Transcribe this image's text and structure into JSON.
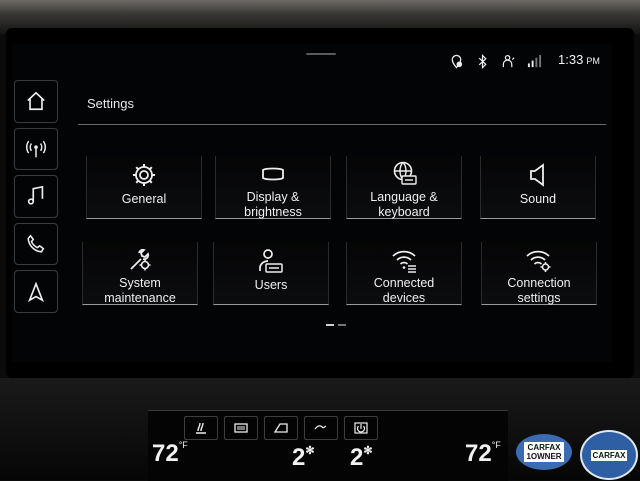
{
  "status_bar": {
    "time": "1:33",
    "ampm": "PM",
    "icons": [
      "location-icon",
      "bluetooth-icon",
      "user-profile-icon",
      "signal-icon"
    ]
  },
  "rail": {
    "items": [
      {
        "name": "home-icon"
      },
      {
        "name": "radio-icon"
      },
      {
        "name": "music-icon"
      },
      {
        "name": "phone-icon"
      },
      {
        "name": "navigation-icon"
      }
    ]
  },
  "page": {
    "title": "Settings"
  },
  "tiles": [
    {
      "label": "General",
      "icon": "gear-icon"
    },
    {
      "label": "Display &\nbrightness",
      "icon": "display-icon"
    },
    {
      "label": "Language &\nkeyboard",
      "icon": "globe-keyboard-icon"
    },
    {
      "label": "Sound",
      "icon": "speaker-icon"
    },
    {
      "label": "System\nmaintenance",
      "icon": "wrench-gear-icon"
    },
    {
      "label": "Users",
      "icon": "user-icon"
    },
    {
      "label": "Connected\ndevices",
      "icon": "wifi-device-icon"
    },
    {
      "label": "Connection\nsettings",
      "icon": "wifi-gear-icon"
    }
  ],
  "pager": {
    "pages": 2,
    "current": 1
  },
  "climate": {
    "left_temp": "72",
    "right_temp": "72",
    "unit": "°F",
    "left_fan": "2",
    "right_fan": "2"
  },
  "badges": {
    "carfax_owner": "CARFAX\n1OWNER",
    "carfax_guarantee": "CARFAX"
  }
}
